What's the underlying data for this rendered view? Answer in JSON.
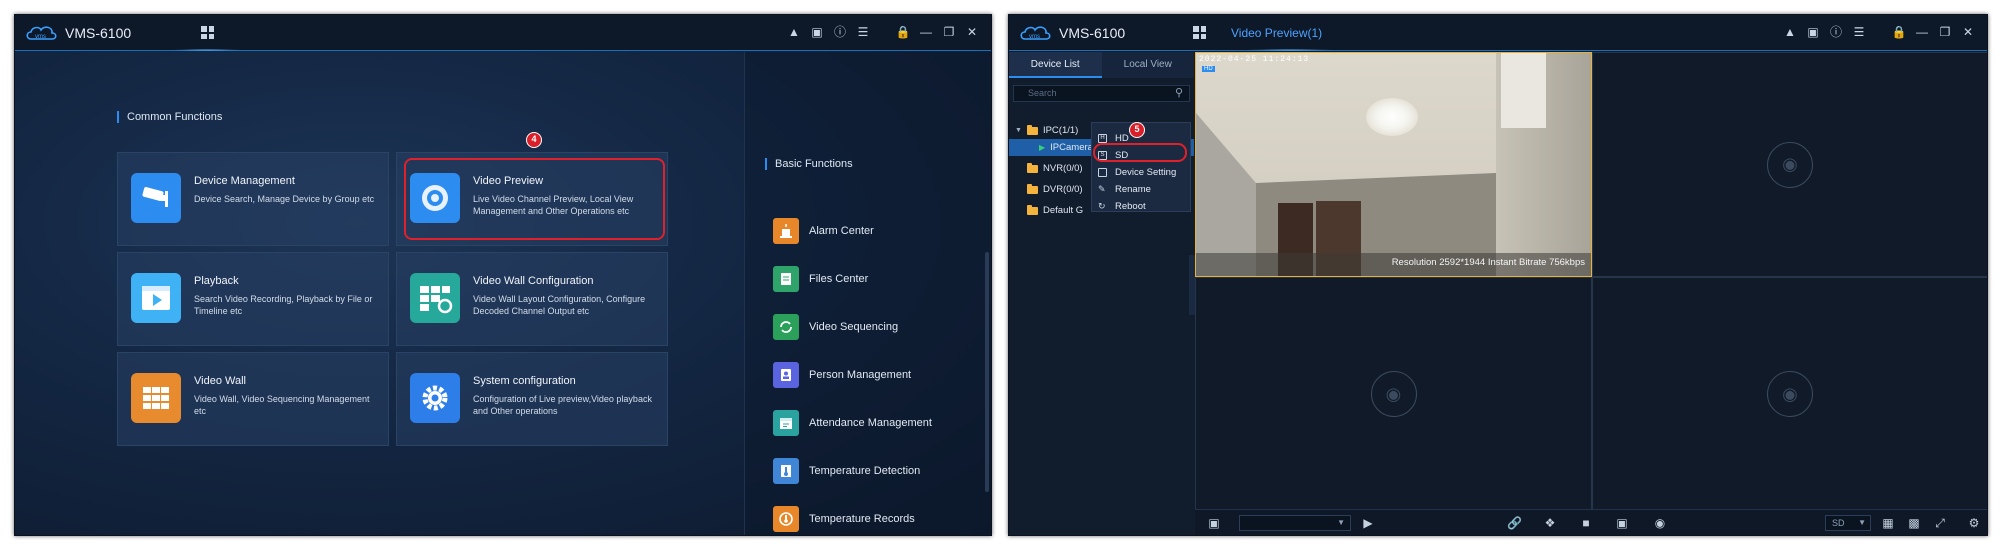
{
  "left_window": {
    "app_title": "VMS-6100",
    "common_functions_label": "Common Functions",
    "basic_functions_label": "Basic Functions",
    "step_badge": "4",
    "cards": [
      {
        "title": "Device Management",
        "desc": "Device Search, Manage Device by Group etc",
        "icon": "camera-icon",
        "color": "#2d8cf0"
      },
      {
        "title": "Video Preview",
        "desc": "Live Video Channel Preview, Local View Management and Other Operations etc",
        "icon": "eye-icon",
        "color": "#2d8cf0"
      },
      {
        "title": "Playback",
        "desc": "Search Video Recording, Playback by File or Timeline etc",
        "icon": "playback-icon",
        "color": "#3fb2f5"
      },
      {
        "title": "Video Wall Configuration",
        "desc": "Video Wall Layout Configuration, Configure Decoded Channel Output etc",
        "icon": "video-wall-config-icon",
        "color": "#26a99a"
      },
      {
        "title": "Video Wall",
        "desc": "Video Wall, Video Sequencing Management etc",
        "icon": "video-wall-icon",
        "color": "#e88a2e"
      },
      {
        "title": "System configuration",
        "desc": "Configuration of Live preview,Video playback and Other operations",
        "icon": "gear-icon",
        "color": "#2d7ee8"
      }
    ],
    "basic_functions": [
      {
        "label": "Alarm Center",
        "icon": "alarm-icon",
        "color": "#e8872a"
      },
      {
        "label": "Files Center",
        "icon": "files-icon",
        "color": "#2fa46a"
      },
      {
        "label": "Video Sequencing",
        "icon": "sequencing-icon",
        "color": "#2aa05a"
      },
      {
        "label": "Person Management",
        "icon": "person-icon",
        "color": "#5a63e0"
      },
      {
        "label": "Attendance Management",
        "icon": "attendance-icon",
        "color": "#2aa3a0"
      },
      {
        "label": "Temperature Detection",
        "icon": "temperature-icon",
        "color": "#3f86d6"
      },
      {
        "label": "Temperature Records",
        "icon": "records-icon",
        "color": "#e8872a"
      }
    ]
  },
  "right_window": {
    "app_title": "VMS-6100",
    "tab_title": "Video Preview(1)",
    "panel_tabs": [
      "Device List",
      "Local View"
    ],
    "search_placeholder": "Search",
    "tree": [
      {
        "label": "IPC(1/1)",
        "level": 0
      },
      {
        "label": "IPCamera",
        "level": 1
      },
      {
        "label": "NVR(0/0)",
        "level": 0
      },
      {
        "label": "DVR(0/0)",
        "level": 0
      },
      {
        "label": "Default G",
        "level": 0
      }
    ],
    "step_badge": "5",
    "context_menu": [
      "HD",
      "SD",
      "Device Setting",
      "Rename",
      "Reboot"
    ],
    "video_timestamp": "2022-04-25 11:24:13",
    "video_tag": "HD",
    "video_info": "Resolution 2592*1944   Instant Bitrate 756kbps",
    "stream_select": "SD"
  },
  "colors": {
    "accent": "#2d8cf0",
    "highlight": "#e0202a"
  }
}
